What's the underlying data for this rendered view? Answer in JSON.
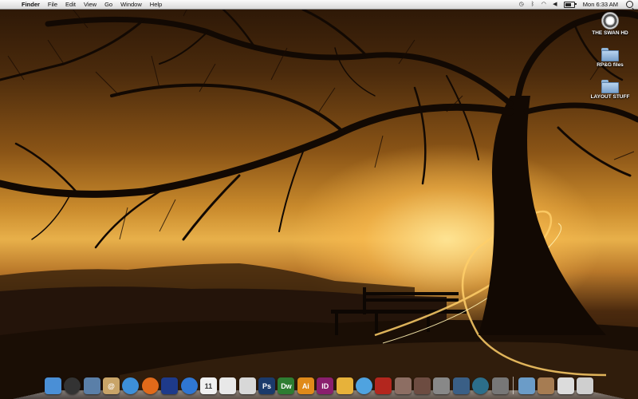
{
  "menubar": {
    "apple": "",
    "items": [
      "Finder",
      "File",
      "Edit",
      "View",
      "Go",
      "Window",
      "Help"
    ],
    "status_icons": [
      "time-machine-icon",
      "bluetooth-icon",
      "wifi-icon",
      "volume-icon"
    ],
    "clock": "Mon 6:33 AM"
  },
  "desktop_icons": [
    {
      "label": "THE SWAN HD",
      "icon": "hard-drive-icon"
    },
    {
      "label": "RP&G files",
      "icon": "folder-icon"
    },
    {
      "label": "LAYOUT STUFF",
      "icon": "folder-icon"
    }
  ],
  "dock": {
    "items": [
      {
        "name": "finder",
        "label": "",
        "bg": "#4a8fd6"
      },
      {
        "name": "dashboard",
        "label": "",
        "bg": "#333333"
      },
      {
        "name": "preview",
        "label": "",
        "bg": "#5a7fa8"
      },
      {
        "name": "address-book",
        "label": "@",
        "bg": "#c8a468"
      },
      {
        "name": "safari",
        "label": "",
        "bg": "#3d8fd8"
      },
      {
        "name": "firefox",
        "label": "",
        "bg": "#e06a1a"
      },
      {
        "name": "ichat",
        "label": "",
        "bg": "#1e3a8a"
      },
      {
        "name": "ichat-video",
        "label": "",
        "bg": "#2f76d2"
      },
      {
        "name": "ical",
        "label": "11",
        "bg": "#f0f0f0"
      },
      {
        "name": "textedit",
        "label": "",
        "bg": "#e8e8e8"
      },
      {
        "name": "mail",
        "label": "",
        "bg": "#d8d8d8"
      },
      {
        "name": "photoshop",
        "label": "Ps",
        "bg": "#1b3a6b"
      },
      {
        "name": "dreamweaver",
        "label": "Dw",
        "bg": "#2e7d32"
      },
      {
        "name": "illustrator",
        "label": "Ai",
        "bg": "#e08a1a"
      },
      {
        "name": "indesign",
        "label": "ID",
        "bg": "#8a1f6e"
      },
      {
        "name": "sherlock",
        "label": "",
        "bg": "#e7b23a"
      },
      {
        "name": "itunes",
        "label": "",
        "bg": "#4fa3e0"
      },
      {
        "name": "photo-booth",
        "label": "",
        "bg": "#b3261e"
      },
      {
        "name": "iphoto",
        "label": "",
        "bg": "#8d6e63"
      },
      {
        "name": "image-capture",
        "label": "",
        "bg": "#6d4c41"
      },
      {
        "name": "automator",
        "label": "",
        "bg": "#888888"
      },
      {
        "name": "spaces",
        "label": "",
        "bg": "#3a5f86"
      },
      {
        "name": "time-machine",
        "label": "",
        "bg": "#2c6e8a"
      },
      {
        "name": "system-preferences",
        "label": "",
        "bg": "#777777"
      },
      {
        "name": "applications-stack",
        "label": "",
        "bg": "#6b9cc8"
      },
      {
        "name": "documents-stack",
        "label": "",
        "bg": "#a67c52"
      },
      {
        "name": "downloads-stack",
        "label": "",
        "bg": "#dcdcdc"
      },
      {
        "name": "trash",
        "label": "",
        "bg": "#cfcfcf"
      }
    ]
  }
}
